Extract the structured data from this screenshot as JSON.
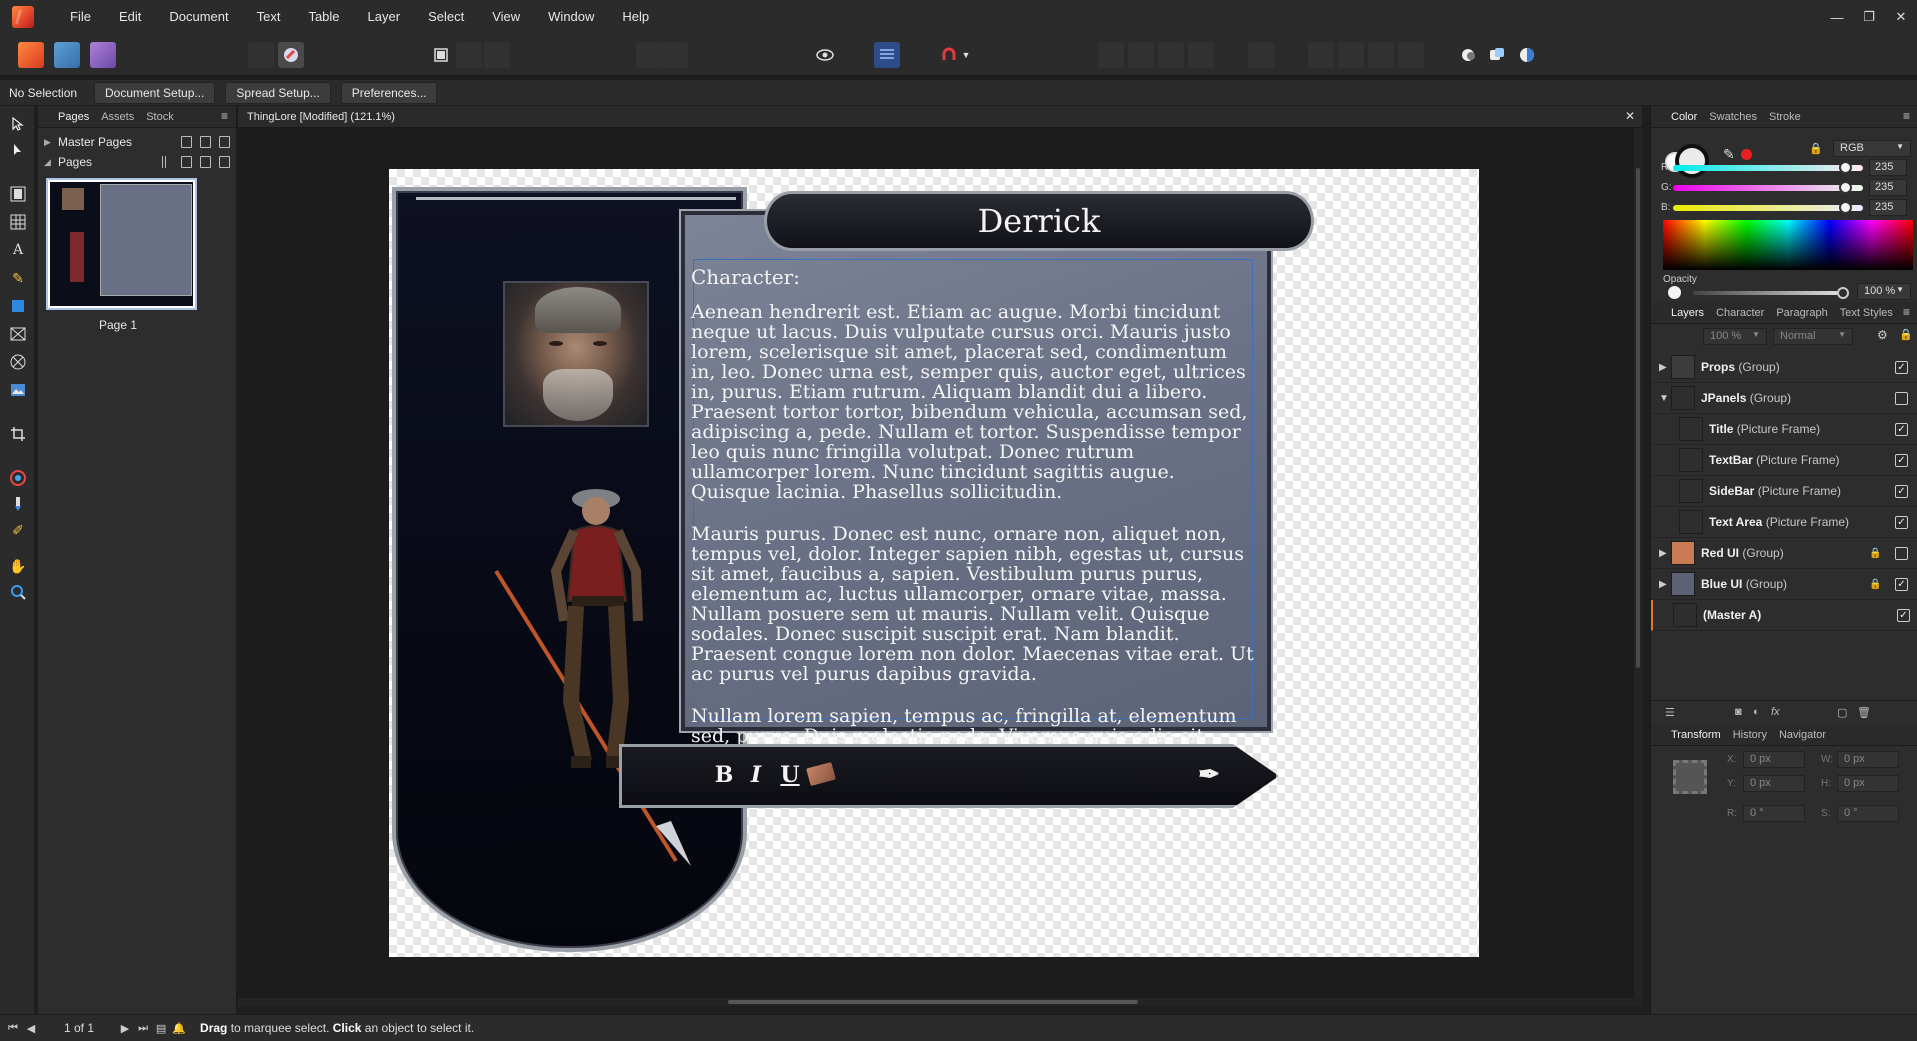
{
  "menu": [
    "File",
    "Edit",
    "Document",
    "Text",
    "Table",
    "Layer",
    "Select",
    "View",
    "Window",
    "Help"
  ],
  "window_controls": {
    "minimize": "—",
    "restore": "❐",
    "close": "✕"
  },
  "context_bar": {
    "label": "No Selection",
    "buttons": [
      "Document Setup...",
      "Spread Setup...",
      "Preferences..."
    ]
  },
  "pages_panel": {
    "tabs": [
      "Pages",
      "Assets",
      "Stock"
    ],
    "master_pages_label": "Master Pages",
    "pages_label": "Pages",
    "page_name": "Page 1"
  },
  "document": {
    "tab_title": "ThingLore [Modified] (121.1%)",
    "character_name": "Derrick",
    "heading": "Character:",
    "paragraphs": [
      "Aenean hendrerit est. Etiam ac augue. Morbi tincidunt neque ut lacus. Duis vulputate cursus orci. Mauris justo lorem, scelerisque sit amet, placerat sed, condimentum in, leo. Donec urna est, semper quis, auctor eget, ultrices in, purus. Etiam rutrum. Aliquam blandit dui a libero. Praesent tortor tortor, bibendum vehicula, accumsan sed, adipiscing a, pede. Nullam et tortor. Suspendisse tempor leo quis nunc fringilla volutpat. Donec rutrum ullamcorper lorem. Nunc tincidunt sagittis augue. Quisque lacinia. Phasellus sollicitudin.",
      "Mauris purus. Donec est nunc, ornare non, aliquet non, tempus vel, dolor. Integer sapien nibh, egestas ut, cursus sit amet, faucibus a, sapien. Vestibulum purus purus, elementum ac, luctus ullamcorper, ornare vitae, massa. Nullam posuere sem ut mauris. Nullam velit. Quisque sodales. Donec suscipit suscipit erat. Nam blandit. Praesent congue lorem non dolor. Maecenas vitae erat. Ut ac purus vel purus dapibus gravida.",
      "Nullam lorem sapien, tempus ac, fringilla at, elementum sed, purus. Duis molestie pede. Vivamus quis odio sit amet libero"
    ],
    "textbar_buttons": {
      "bold": "B",
      "italic": "I",
      "underline": "U",
      "quill": "✒"
    }
  },
  "color_panel": {
    "tabs": [
      "Color",
      "Swatches",
      "Stroke"
    ],
    "model": "RGB",
    "channels": [
      {
        "label": "R:",
        "value": "235",
        "gradient": "linear-gradient(90deg,#00ebeb,#ffebeb)"
      },
      {
        "label": "G:",
        "value": "235",
        "gradient": "linear-gradient(90deg,#eb00eb,#ebffeb)"
      },
      {
        "label": "B:",
        "value": "235",
        "gradient": "linear-gradient(90deg,#ebeb00,#ebebff)"
      }
    ],
    "opacity_label": "Opacity",
    "opacity_value": "100 %"
  },
  "layers_panel": {
    "tabs": [
      "Layers",
      "Character",
      "Paragraph",
      "Text Styles"
    ],
    "opacity": "100 %",
    "blend_mode": "Normal",
    "layers": [
      {
        "name": "Props",
        "type": "(Group)",
        "level": 0,
        "arrow": "▶",
        "checked": true,
        "locked": false,
        "thumb": "#3c3c3c"
      },
      {
        "name": "JPanels",
        "type": "(Group)",
        "level": 0,
        "arrow": "▼",
        "checked": false,
        "locked": false,
        "thumb": "#2e2e2e"
      },
      {
        "name": "Title",
        "type": "(Picture Frame)",
        "level": 1,
        "arrow": "",
        "checked": true,
        "locked": false,
        "thumb": "#2e2e2e"
      },
      {
        "name": "TextBar",
        "type": "(Picture Frame)",
        "level": 1,
        "arrow": "",
        "checked": true,
        "locked": false,
        "thumb": "#2e2e2e"
      },
      {
        "name": "SideBar",
        "type": "(Picture Frame)",
        "level": 1,
        "arrow": "",
        "checked": true,
        "locked": false,
        "thumb": "#2e2e2e"
      },
      {
        "name": "Text Area",
        "type": "(Picture Frame)",
        "level": 1,
        "arrow": "",
        "checked": true,
        "locked": false,
        "thumb": "#2e2e2e"
      },
      {
        "name": "Red UI",
        "type": "(Group)",
        "level": 0,
        "arrow": "▶",
        "checked": false,
        "locked": true,
        "thumb": "#c97b54"
      },
      {
        "name": "Blue UI",
        "type": "(Group)",
        "level": 0,
        "arrow": "▶",
        "checked": true,
        "locked": true,
        "thumb": "#5d6174"
      },
      {
        "name": "(Master A)",
        "type": "",
        "level": 0,
        "arrow": "",
        "checked": true,
        "locked": false,
        "thumb": "#2e2e2e"
      }
    ]
  },
  "transform_panel": {
    "tabs": [
      "Transform",
      "History",
      "Navigator"
    ],
    "fields": [
      {
        "label": "X:",
        "value": "0 px"
      },
      {
        "label": "Y:",
        "value": "0 px"
      },
      {
        "label": "W:",
        "value": "0 px"
      },
      {
        "label": "H:",
        "value": "0 px"
      },
      {
        "label": "R:",
        "value": "0 °"
      },
      {
        "label": "S:",
        "value": "0 °"
      }
    ]
  },
  "status_bar": {
    "page_count": "1 of 1",
    "hint_drag": "Drag",
    "hint_middle": " to marquee select. ",
    "hint_click": "Click",
    "hint_end": " an object to select it."
  }
}
